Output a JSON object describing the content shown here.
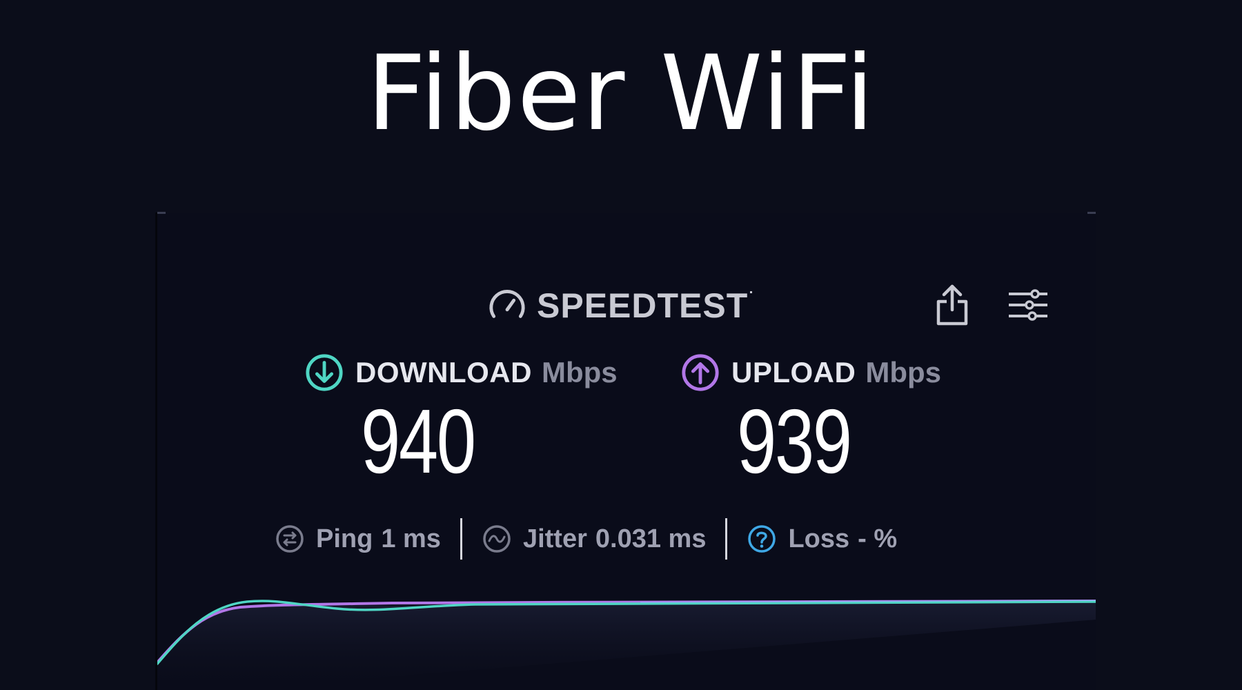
{
  "title": "Fiber WiFi",
  "speedtest": {
    "brand": "SPEEDTEST",
    "icons": {
      "brand": "speedometer-icon",
      "share": "share-icon",
      "settings": "sliders-icon"
    },
    "download": {
      "icon": "download-arrow-icon",
      "label": "DOWNLOAD",
      "unit": "Mbps",
      "value": "940",
      "color": "#4fd6c4"
    },
    "upload": {
      "icon": "upload-arrow-icon",
      "label": "UPLOAD",
      "unit": "Mbps",
      "value": "939",
      "color": "#b277e8"
    },
    "stats": {
      "ping": {
        "icon": "ping-icon",
        "label": "Ping",
        "value": "1 ms"
      },
      "jitter": {
        "icon": "jitter-icon",
        "label": "Jitter",
        "value": "0.031 ms"
      },
      "loss": {
        "icon": "help-circle-icon",
        "label": "Loss",
        "value": "- %",
        "color": "#3fa8e6"
      }
    }
  }
}
